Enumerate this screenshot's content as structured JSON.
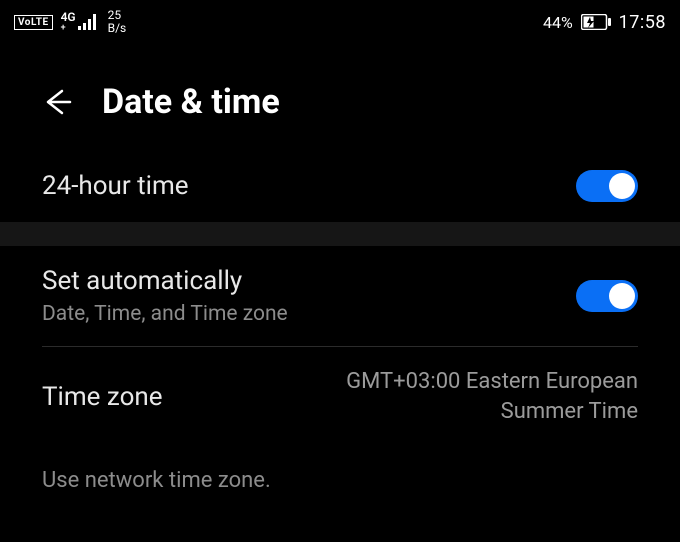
{
  "status": {
    "volte": "VoLTE",
    "network_label": "4G",
    "network_sub": "+",
    "speed_top": "25",
    "speed_bottom": "B/s",
    "battery_pct": "44%",
    "time": "17:58"
  },
  "header": {
    "title": "Date & time"
  },
  "rows": {
    "hour24": {
      "label": "24-hour time"
    },
    "auto": {
      "label": "Set automatically",
      "sub": "Date, Time, and Time zone"
    },
    "tz": {
      "label": "Time zone",
      "value": "GMT+03:00 Eastern European Summer Time"
    }
  },
  "note": "Use network time zone."
}
